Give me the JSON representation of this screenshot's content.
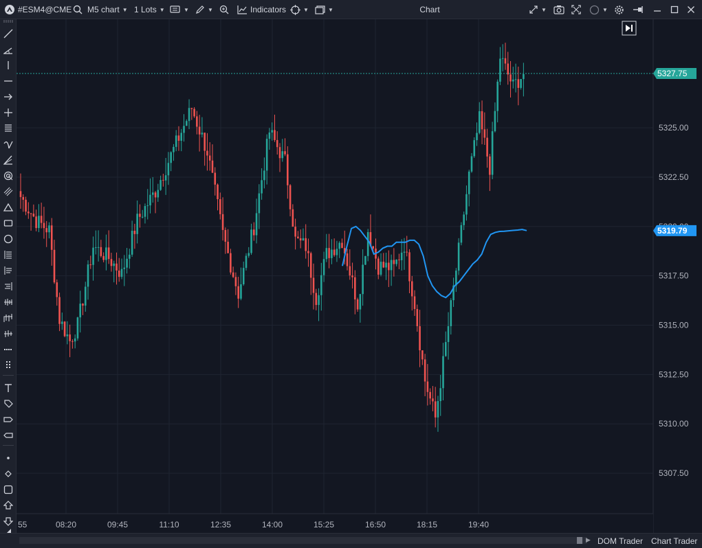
{
  "toolbar": {
    "symbol": "#ESM4@CME",
    "chart_type": "M5 chart",
    "lots": "1 Lots",
    "indicators_label": "Indicators",
    "window_title": "Chart"
  },
  "bottom": {
    "dom_trader": "DOM Trader",
    "chart_trader": "Chart Trader"
  },
  "colors": {
    "background": "#131722",
    "panel": "#1e222d",
    "bull": "#26a69a",
    "bear": "#ef5350",
    "ma_line": "#2196f3",
    "last_price": "#26a69a"
  },
  "chart_data": {
    "type": "candlestick",
    "title": "",
    "xlabel": "",
    "ylabel": "",
    "ylim": [
      5305.45,
      5330.5
    ],
    "price_ticks": [
      "5325.00",
      "5322.50",
      "5320.00",
      "5317.50",
      "5315.00",
      "5312.50",
      "5310.00",
      "5307.50"
    ],
    "time_ticks": [
      "08:20",
      "09:45",
      "11:10",
      "12:35",
      "14:00",
      "15:25",
      "16:50",
      "18:15",
      "19:40"
    ],
    "time_ticks_partial": [
      "55"
    ],
    "last_price": "5327.75",
    "indicator_value": "5319.79",
    "grid": true,
    "candles": [],
    "ma_line": [
      [
        5318.0,
        5319.0,
        5319.9,
        5320.0,
        5319.8,
        5319.5,
        5319.2,
        5318.6,
        5318.7,
        5318.9,
        5319.0,
        5319.0,
        5319.2,
        5319.2,
        5319.2,
        5319.3,
        5319.3,
        5319.1,
        5318.5,
        5317.5,
        5317.0,
        5316.7,
        5316.5,
        5316.4,
        5316.6,
        5317.0,
        5317.2,
        5317.5,
        5317.8,
        5318.1,
        5318.3,
        5318.6,
        5319.2,
        5319.6,
        5319.7,
        5319.75,
        5319.76,
        5319.78,
        5319.8,
        5319.82,
        5319.85,
        5319.79
      ]
    ]
  }
}
